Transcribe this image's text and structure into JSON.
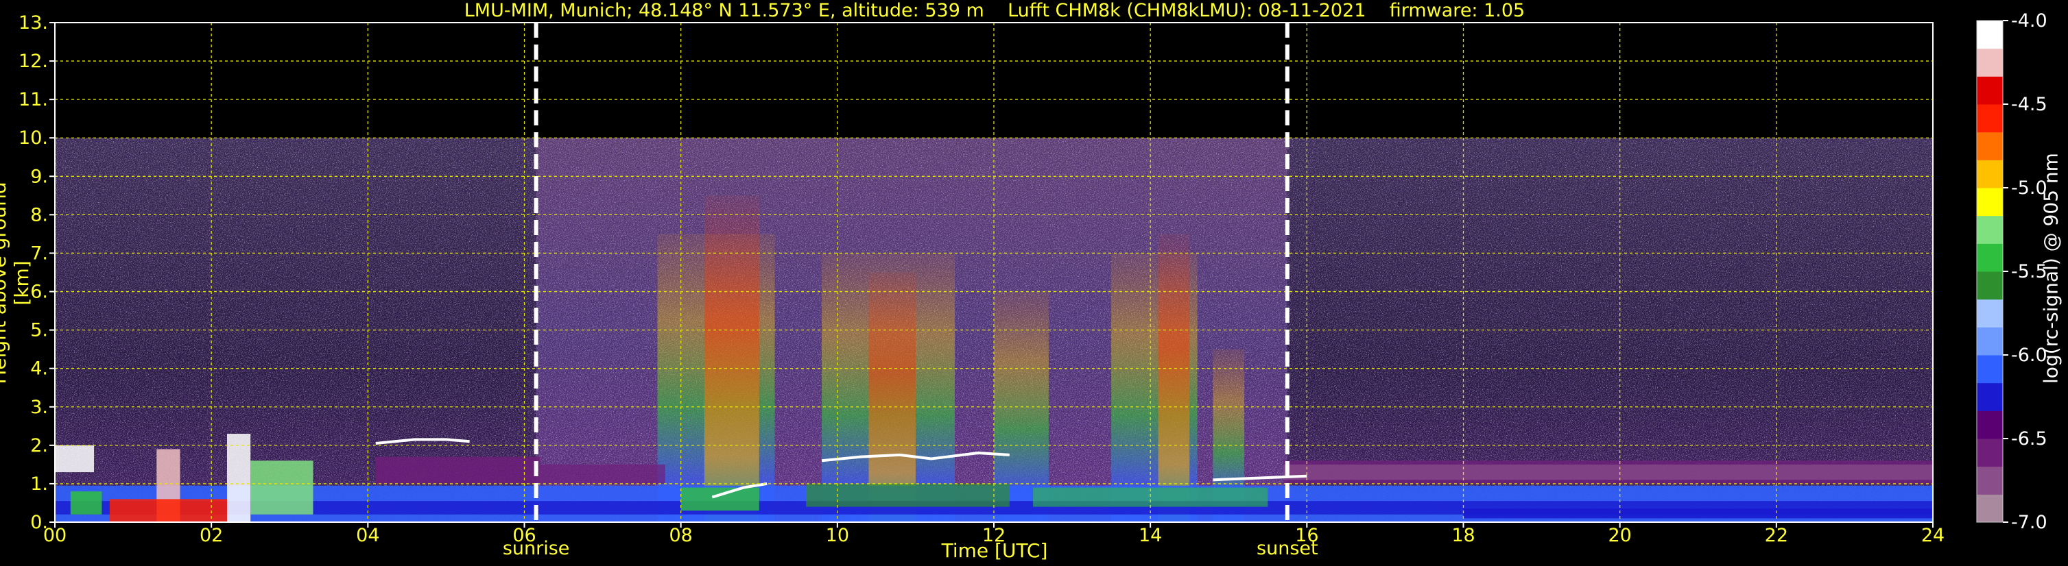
{
  "chart_data": {
    "type": "heatmap",
    "title": "LMU-MIM, Munich; 48.148° N 11.573° E, altitude: 539 m    Lufft CHM8k (CHM8kLMU): 08-11-2021    firmware: 1.05",
    "xlabel": "Time [UTC]",
    "ylabel": "Height above ground [km]",
    "colorbar_label": "log(rc-signal) @ 905 nm",
    "xlim": [
      0,
      24
    ],
    "ylim": [
      0,
      13
    ],
    "x_ticks": [
      "00",
      "02",
      "04",
      "06",
      "08",
      "10",
      "12",
      "14",
      "16",
      "18",
      "20",
      "22",
      "24"
    ],
    "y_ticks": [
      "0.",
      "1.",
      "2.",
      "3.",
      "4.",
      "5.",
      "6.",
      "7.",
      "8.",
      "9.",
      "10.",
      "11.",
      "12.",
      "13."
    ],
    "colorbar_ticks": [
      "-4.0",
      "-4.5",
      "-5.0",
      "-5.5",
      "-6.0",
      "-6.5",
      "-7.0"
    ],
    "colorbar_range": [
      -7.0,
      -4.0
    ],
    "grid": true,
    "measurement_top_km": 10,
    "events": [
      {
        "label": "sunrise",
        "time": 6.15
      },
      {
        "label": "sunset",
        "time": 15.75
      }
    ],
    "colors": {
      "text": "#ffff33",
      "grid": "#e6e600",
      "background": "#000000",
      "colormap": [
        "#a8899e",
        "#8a4f8a",
        "#6f1f7a",
        "#5a0073",
        "#1a1ad0",
        "#3060ff",
        "#6f9bff",
        "#a4c4ff",
        "#2e8f2e",
        "#2fbf3f",
        "#7fe080",
        "#ffff00",
        "#ffc000",
        "#ff7000",
        "#ff2000",
        "#e00000",
        "#f0c0c0",
        "#ffffff"
      ]
    }
  }
}
